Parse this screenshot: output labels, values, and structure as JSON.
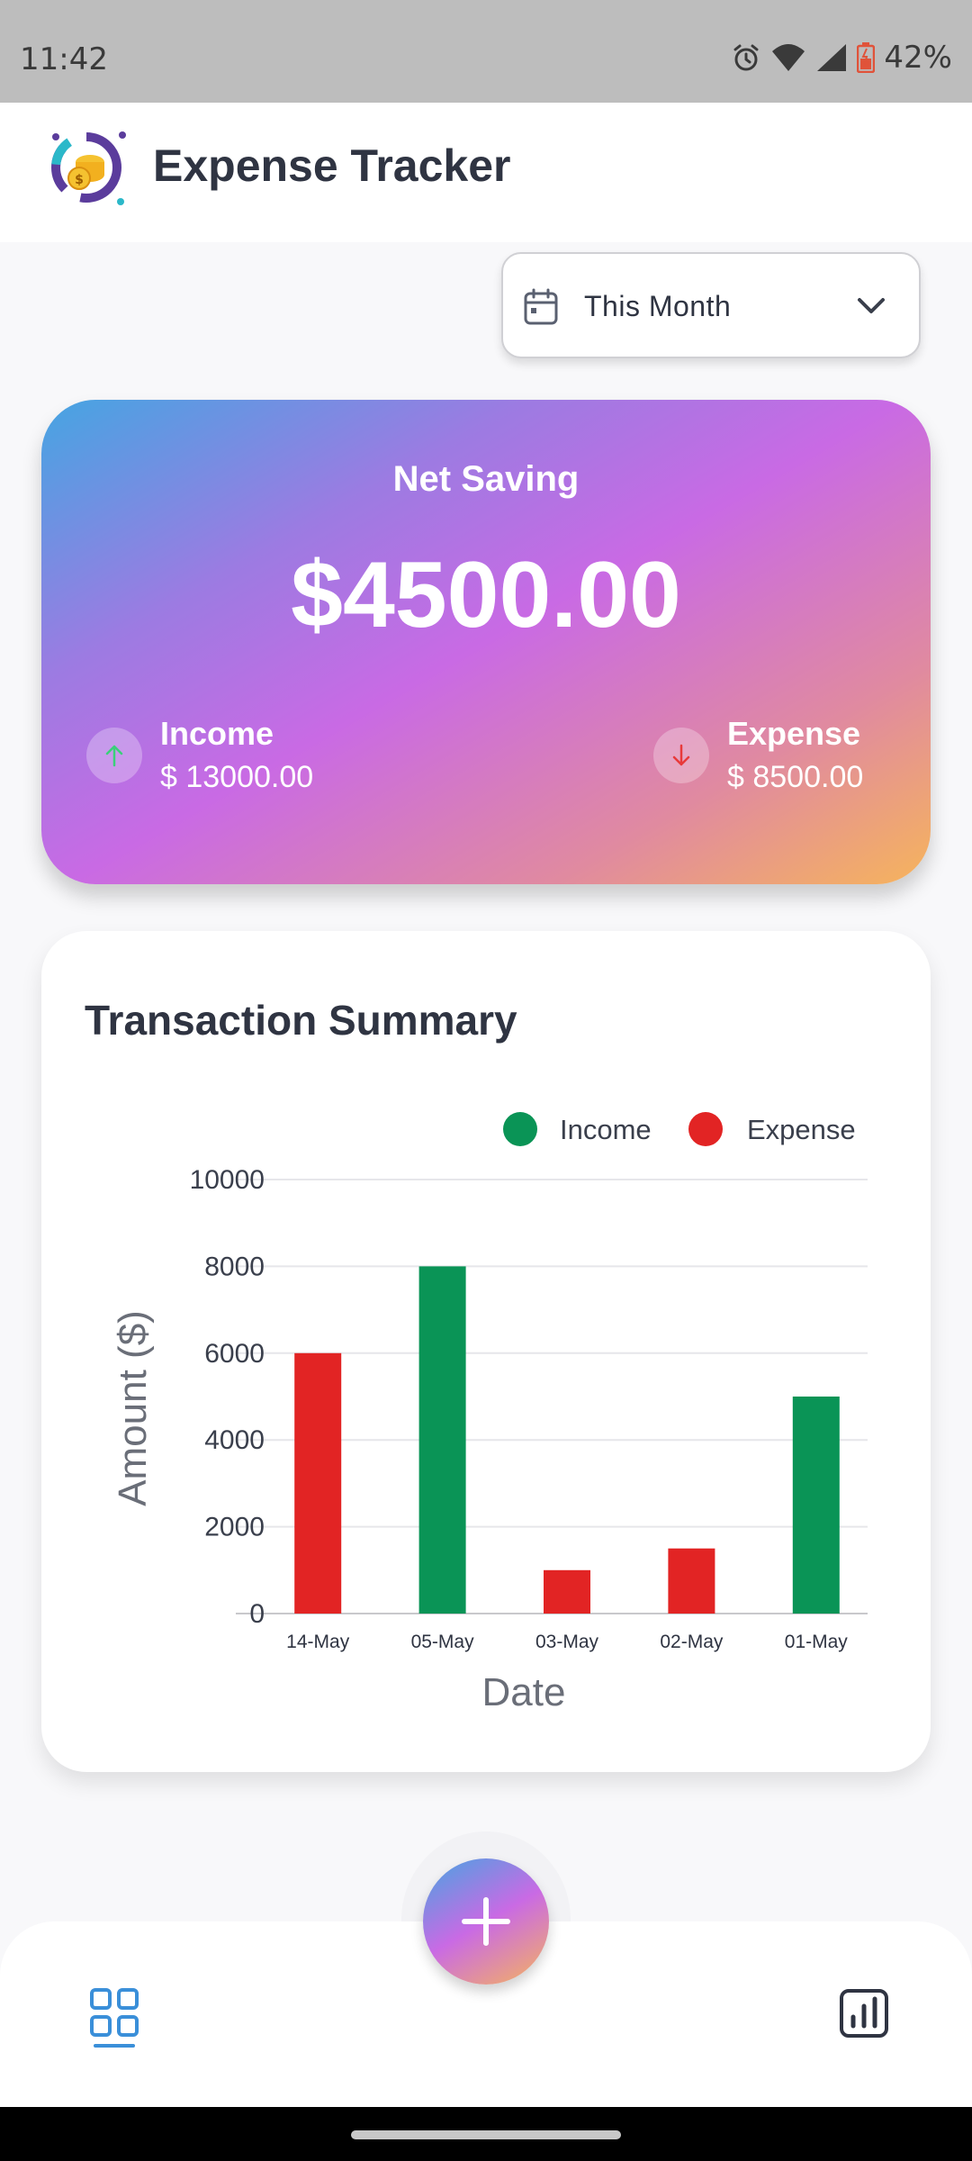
{
  "status_bar": {
    "time": "11:42",
    "battery": "42%",
    "icons": [
      "alarm-icon",
      "wifi-icon",
      "signal-icon",
      "battery-icon"
    ]
  },
  "header": {
    "title": "Expense Tracker",
    "logo_icon": "coins-chart-logo"
  },
  "period_filter": {
    "selected": "This Month",
    "icon": "calendar-icon"
  },
  "summary": {
    "title": "Net Saving",
    "amount": "$4500.00",
    "income_label": "Income",
    "income_value": "$ 13000.00",
    "expense_label": "Expense",
    "expense_value": "$ 8500.00"
  },
  "colors": {
    "income": "#0a9456",
    "expense": "#e22424",
    "text_dark": "#2f3442",
    "accent_blue": "#3a8fd9"
  },
  "chart_data": {
    "type": "bar",
    "title": "Transaction Summary",
    "xlabel": "Date",
    "ylabel": "Amount ($)",
    "ylim": [
      0,
      10000
    ],
    "yticks": [
      0,
      2000,
      4000,
      6000,
      8000,
      10000
    ],
    "grid": true,
    "legend_position": "top-right",
    "legend": [
      "Income",
      "Expense"
    ],
    "categories": [
      "14-May",
      "05-May",
      "03-May",
      "02-May",
      "01-May"
    ],
    "series": [
      {
        "name": "Income",
        "color": "#0a9456",
        "values": [
          0,
          8000,
          0,
          0,
          5000
        ]
      },
      {
        "name": "Expense",
        "color": "#e22424",
        "values": [
          6000,
          0,
          1000,
          1500,
          0
        ]
      }
    ]
  },
  "nav": {
    "items": [
      "dashboard-icon",
      "stats-icon"
    ],
    "fab_icon": "plus-icon"
  }
}
